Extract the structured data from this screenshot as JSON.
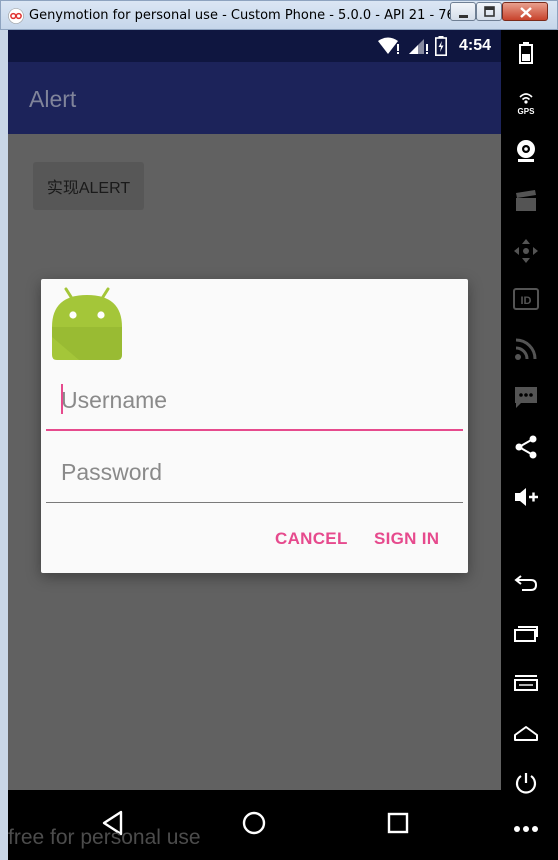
{
  "window": {
    "title": "Genymotion for personal use - Custom Phone - 5.0.0 - API 21 - 768x12..."
  },
  "status_bar": {
    "time": "4:54"
  },
  "app_bar": {
    "title": "Alert"
  },
  "main": {
    "alert_button_label": "实现ALERT"
  },
  "dialog": {
    "username_placeholder": "Username",
    "password_placeholder": "Password",
    "cancel_label": "CANCEL",
    "sign_in_label": "SIGN IN"
  },
  "watermark": "free for personal use",
  "toolbar": {
    "gps_label": "GPS",
    "id_label": "ID"
  },
  "colors": {
    "accent": "#e64a8d",
    "app_bar": "#1c235a",
    "status_bar": "#0f1640",
    "android_green": "#a4c639"
  },
  "icons": {
    "toolbar": [
      "battery-icon",
      "gps-icon",
      "webcam-icon",
      "clapperboard-icon",
      "dpad-icon",
      "id-icon",
      "rss-icon",
      "sms-icon",
      "share-icon",
      "volume-up-icon",
      "back-icon",
      "recent-apps-icon",
      "menu-icon",
      "home-icon",
      "power-icon",
      "more-icon"
    ],
    "nav": [
      "back-triangle-icon",
      "home-circle-icon",
      "recents-square-icon"
    ]
  }
}
